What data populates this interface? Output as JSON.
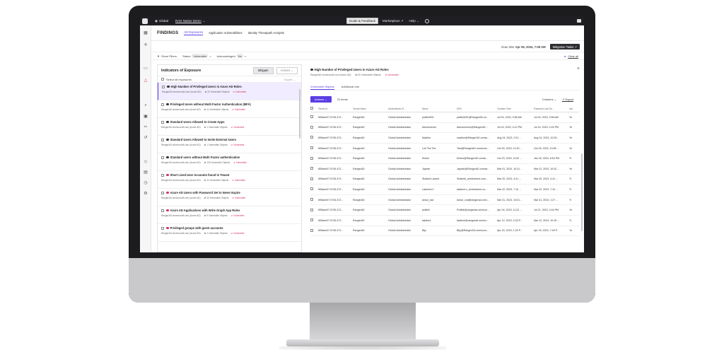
{
  "topbar": {
    "org": "Global",
    "workspace": "RAD Native Demo",
    "guide": "Guide & Feedback",
    "marketplace": "Marketplace",
    "help": "Help"
  },
  "findings": {
    "title": "FINDINGS",
    "tabs": [
      "AD Exposures",
      "Application Vulnerabilities",
      "Identity Threatpath Analysis"
    ],
    "scan_label": "Scan time",
    "scan_time": "Apr 06, 2024, 7:08 AM",
    "mitigation_tasks": "Mitigation Tasks"
  },
  "filters": {
    "show_filters": "Show Filters",
    "status_label": "Status",
    "status_value": "Vulnerable",
    "ack_label": "Acknowledged",
    "ack_value": "No",
    "clear_all": "Clear all"
  },
  "ioe": {
    "title": "Indicators of Exposure",
    "mitigate": "Mitigate",
    "actions": "Actions",
    "select_all": "Select all exposures",
    "export": "Export",
    "items": [
      {
        "title": "High Number of Privileged Users in Azure AD Roles",
        "tenant": "RangerAD.onmicrosoft.com (Azure AD)",
        "objects": "20 Vulnerable Objects",
        "status": "Vulnerable",
        "color": "#333333"
      },
      {
        "title": "Privileged Users without Multi Factor Authentication (MFA)",
        "tenant": "RangerAD.onmicrosoft.com (Azure AD)",
        "objects": "11 Vulnerable Objects",
        "status": "Vulnerable",
        "color": "#333333"
      },
      {
        "title": "Standard Users Allowed to Create Apps",
        "tenant": "RangerAD.onmicrosoft.com (Azure AD)",
        "objects": "1 Vulnerable Objects",
        "status": "Vulnerable",
        "color": "#333333"
      },
      {
        "title": "Standard Users Allowed to Invite External Users",
        "tenant": "RangerAD.onmicrosoft.com (Azure AD)",
        "objects": "1 Vulnerable Objects",
        "status": "Vulnerable",
        "color": "#333333"
      },
      {
        "title": "Standard users without Multi Factor authentication",
        "tenant": "RangerAD.onmicrosoft.com (Azure AD)",
        "objects": "133 Vulnerable Objects",
        "status": "Vulnerable",
        "color": "#333333"
      },
      {
        "title": "Short Lived User Accounts found in Tenant",
        "tenant": "RangerAD.onmicrosoft.com (Azure AD)",
        "objects": "11 Vulnerable Objects",
        "status": "Vulnerable",
        "color": "#d4365e"
      },
      {
        "title": "Azure AD Users with Password Set to Never Expire",
        "tenant": "RangerAD.onmicrosoft.com (Azure AD)",
        "objects": "20 Vulnerable Objects",
        "status": "Vulnerable",
        "color": "#d4365e"
      },
      {
        "title": "Azure AD Applications with Write Graph App Roles",
        "tenant": "RangerAD.onmicrosoft.com (Azure AD)",
        "objects": "9 Vulnerable Objects",
        "status": "Vulnerable",
        "color": "#d4365e"
      },
      {
        "title": "Privileged groups with guest accounts",
        "tenant": "RangerAD.onmicrosoft.com (Azure AD)",
        "objects": "2 Vulnerable Objects",
        "status": "Vulnerable",
        "color": "#d4365e"
      }
    ]
  },
  "detail": {
    "title": "High Number of Privileged Users in Azure AD Roles",
    "tenant": "RangerAD.onmicrosoft.com (Azure AD)",
    "objects": "20 Vulnerable Objects",
    "status": "Vulnerable",
    "tabs": [
      "Vulnerable Objects",
      "Additional Info"
    ],
    "actions": "Actions",
    "count": "20 Items",
    "columns": "Columns",
    "export": "Export",
    "headers": [
      "Tenant Id",
      "Tenant Name",
      "Administrator R...",
      "Name",
      "UPN",
      "Creation Time",
      "Password Last Se...",
      "Info"
    ],
    "rows": [
      [
        "895aee07-9745-472...",
        "RangerAD",
        "Global Administrator",
        "praffull001",
        "praffull001@RangerAD.on...",
        "Jul 04, 2023, 9:58 AM",
        "Jul 04, 2023, 9:58 AM",
        "Ye"
      ],
      [
        "895aee07-9745-472...",
        "RangerAD",
        "Global Administrator",
        "Adconnector",
        "Adconnector@RangerAD...",
        "Jul 24, 2023, 4:12 PM",
        "Jul 24, 2023, 4:24 PM",
        "Ye"
      ],
      [
        "895aee07-9745-472...",
        "RangerAD",
        "Global Administrator",
        "Madhur",
        "madhur@RangerAD.onmic...",
        "Aug 24, 2023, 2:51 ...",
        "Aug 24, 2023, 10:25...",
        "Ye"
      ],
      [
        "895aee07-9745-472...",
        "RangerAD",
        "Global Administrator",
        "Loh Tee Tee",
        "Test@RangerAD.onmicros...",
        "Oct 09, 2023, 10:20 ...",
        "Oct 09, 2023, 10:55 ...",
        "Ye"
      ],
      [
        "895aee07-9745-472...",
        "RangerAD",
        "Global Administrator",
        "Kishor",
        "Kishor@RangerAD.onmic...",
        "Oct 23, 2023, 11:52 ...",
        "Jan 25, 2024, 6:53 PM",
        "Tr"
      ],
      [
        "895aee07-9745-472...",
        "RangerAD",
        "Global Administrator",
        "Jayesh",
        "Jayesh@RangerAD.onmicr...",
        "Mar 01, 2024, 10:31 ...",
        "Mar 01, 2024, 10:42...",
        "Ye"
      ],
      [
        "895aee07-9745-472...",
        "RangerAD",
        "Global Administrator",
        "Shaked Lamed",
        "Shakedl_sentinelone.com...",
        "Mar 20, 2023, 4:41 ...",
        "Mar 20, 2023, 4:41 ...",
        "Tr"
      ],
      [
        "895aee07-9745-472...",
        "RangerAD",
        "Global Administrator",
        "Lakshmi C",
        "lakshmi.c_sentinelone.co...",
        "Mar 22, 2023, 7:10 ...",
        "Mar 22, 2023, 7:10 ...",
        "Tr"
      ],
      [
        "895aee07-9745-472...",
        "RangerAD",
        "Global Administrator",
        "ankur_rad",
        "Ankur_rad@rangerad.onm...",
        "Mar 31, 2023, 10:01 ...",
        "Mar 31, 2023, 1:27 ...",
        "Tr"
      ],
      [
        "895aee07-9745-472...",
        "RangerAD",
        "Global Administrator",
        "praffull",
        "Praffull@rangerad.onmicro...",
        "Apr 04, 2023, 11:22 ...",
        "Jul 21, 2023, 3:44 PM",
        "Ye"
      ],
      [
        "895aee07-9745-472...",
        "RangerAD",
        "Global Administrator",
        "lakshmi",
        "lakshmi@rangerad.onmicr...",
        "Apr 12, 2023, 4:33 P...",
        "Mar 12, 2024, 10:16 ...",
        "Tr"
      ],
      [
        "895aee07-9745-472...",
        "RangerAD",
        "Global Administrator",
        "Biju",
        "Biju@RangerAD.onmicros...",
        "Apr 20, 2023, 1:33 P...",
        "Apr 29, 2023, 7:49 P...",
        "Ye"
      ]
    ]
  }
}
